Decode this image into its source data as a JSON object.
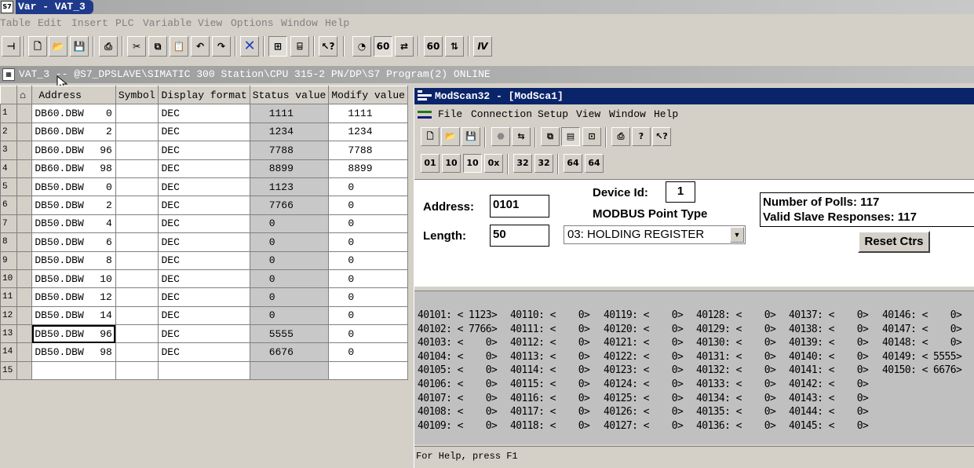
{
  "window": {
    "title": "Var - VAT_3",
    "app_icon": "S7"
  },
  "menubar": [
    "Table",
    "Edit",
    "Insert",
    "PLC",
    "Variable",
    "View",
    "Options",
    "Window",
    "Help"
  ],
  "path": {
    "text": "VAT_3 -- @S7_DPSLAVE\\SIMATIC 300 Station\\CPU 315-2 PN/DP\\S7 Program(2)  ONLINE"
  },
  "vat": {
    "headers": {
      "address": "Address",
      "symbol": "Symbol",
      "format": "Display format",
      "status": "Status value",
      "modify": "Modify value"
    },
    "rows": [
      {
        "n": "1",
        "area": "DB60.DBW",
        "off": "0",
        "fmt": "DEC",
        "status": "1111",
        "modify": "1111"
      },
      {
        "n": "2",
        "area": "DB60.DBW",
        "off": "2",
        "fmt": "DEC",
        "status": "1234",
        "modify": "1234"
      },
      {
        "n": "3",
        "area": "DB60.DBW",
        "off": "96",
        "fmt": "DEC",
        "status": "7788",
        "modify": "7788"
      },
      {
        "n": "4",
        "area": "DB60.DBW",
        "off": "98",
        "fmt": "DEC",
        "status": "8899",
        "modify": "8899"
      },
      {
        "n": "5",
        "area": "DB50.DBW",
        "off": "0",
        "fmt": "DEC",
        "status": "1123",
        "modify": "0"
      },
      {
        "n": "6",
        "area": "DB50.DBW",
        "off": "2",
        "fmt": "DEC",
        "status": "7766",
        "modify": "0"
      },
      {
        "n": "7",
        "area": "DB50.DBW",
        "off": "4",
        "fmt": "DEC",
        "status": "0",
        "modify": "0"
      },
      {
        "n": "8",
        "area": "DB50.DBW",
        "off": "6",
        "fmt": "DEC",
        "status": "0",
        "modify": "0"
      },
      {
        "n": "9",
        "area": "DB50.DBW",
        "off": "8",
        "fmt": "DEC",
        "status": "0",
        "modify": "0"
      },
      {
        "n": "10",
        "area": "DB50.DBW",
        "off": "10",
        "fmt": "DEC",
        "status": "0",
        "modify": "0"
      },
      {
        "n": "11",
        "area": "DB50.DBW",
        "off": "12",
        "fmt": "DEC",
        "status": "0",
        "modify": "0"
      },
      {
        "n": "12",
        "area": "DB50.DBW",
        "off": "14",
        "fmt": "DEC",
        "status": "0",
        "modify": "0"
      },
      {
        "n": "13",
        "area": "DB50.DBW",
        "off": "96",
        "fmt": "DEC",
        "status": "5555",
        "modify": "0"
      },
      {
        "n": "14",
        "area": "DB50.DBW",
        "off": "98",
        "fmt": "DEC",
        "status": "6676",
        "modify": "0"
      },
      {
        "n": "15",
        "area": "",
        "off": "",
        "fmt": "",
        "status": "",
        "modify": ""
      }
    ]
  },
  "modscan": {
    "title": "ModScan32 - [ModSca1]",
    "menu": [
      "File",
      "Connection",
      "Setup",
      "View",
      "Window",
      "Help"
    ],
    "toolbar2": [
      "01",
      "10",
      "10",
      "0x",
      "32",
      "32",
      "64",
      "64"
    ],
    "address_label": "Address:",
    "address_value": "0101",
    "length_label": "Length:",
    "length_value": "50",
    "device_id_label": "Device Id:",
    "device_id_value": "1",
    "point_type_label": "MODBUS Point Type",
    "point_type_value": "03: HOLDING REGISTER",
    "polls": "Number of Polls: 117",
    "valid": "Valid Slave Responses: 117",
    "reset_label": "Reset Ctrs",
    "registers": [
      [
        "40101: < 1123>",
        "40102: < 7766>",
        "40103: <    0>",
        "40104: <    0>",
        "40105: <    0>",
        "40106: <    0>",
        "40107: <    0>",
        "40108: <    0>",
        "40109: <    0>"
      ],
      [
        "40110: <    0>",
        "40111: <    0>",
        "40112: <    0>",
        "40113: <    0>",
        "40114: <    0>",
        "40115: <    0>",
        "40116: <    0>",
        "40117: <    0>",
        "40118: <    0>"
      ],
      [
        "40119: <    0>",
        "40120: <    0>",
        "40121: <    0>",
        "40122: <    0>",
        "40123: <    0>",
        "40124: <    0>",
        "40125: <    0>",
        "40126: <    0>",
        "40127: <    0>"
      ],
      [
        "40128: <    0>",
        "40129: <    0>",
        "40130: <    0>",
        "40131: <    0>",
        "40132: <    0>",
        "40133: <    0>",
        "40134: <    0>",
        "40135: <    0>",
        "40136: <    0>"
      ],
      [
        "40137: <    0>",
        "40138: <    0>",
        "40139: <    0>",
        "40140: <    0>",
        "40141: <    0>",
        "40142: <    0>",
        "40143: <    0>",
        "40144: <    0>",
        "40145: <    0>"
      ],
      [
        "40146: <    0>",
        "40147: <    0>",
        "40148: <    0>",
        "40149: < 5555>",
        "40150: < 6676>"
      ]
    ],
    "status": "For Help, press F1"
  }
}
